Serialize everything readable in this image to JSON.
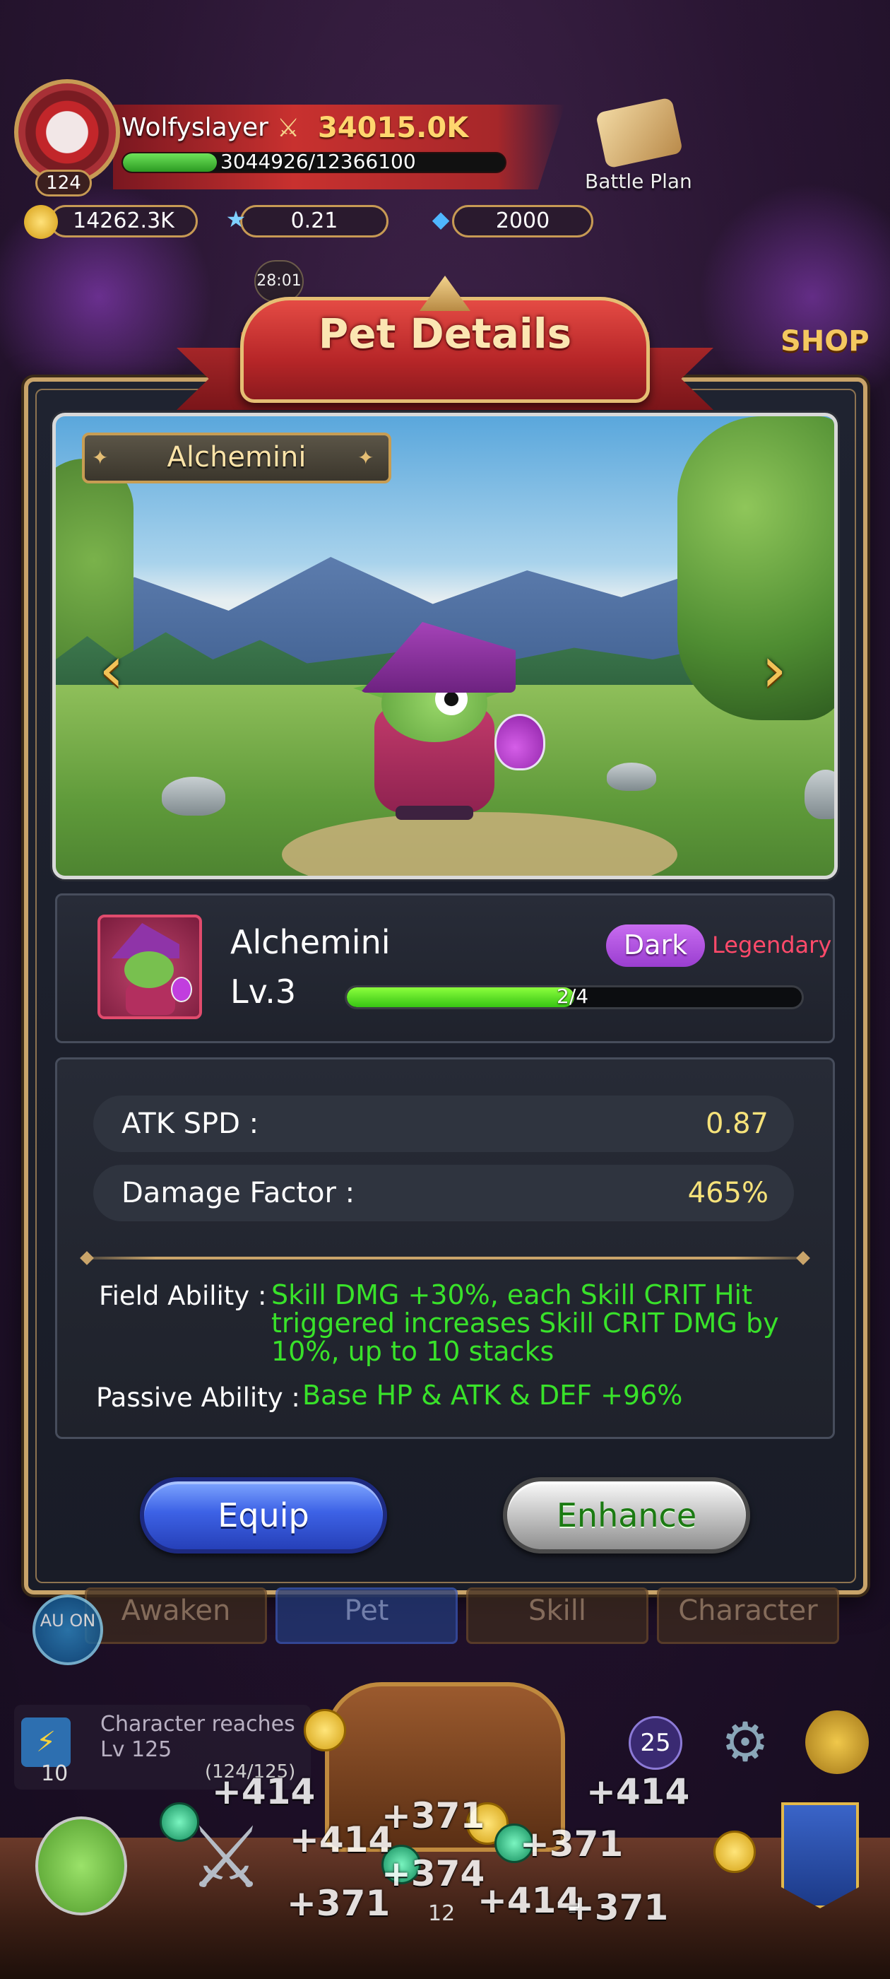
{
  "player": {
    "name": "Wolfyslayer",
    "level": "124",
    "power": "34015.0K",
    "exp_text": "3044926/12366100",
    "exp_fraction": 0.246
  },
  "hud": {
    "battle_plan_label": "Battle Plan",
    "currencies": [
      {
        "icon": "gold-coin-icon",
        "value": "14262.3K"
      },
      {
        "icon": "star-icon",
        "value": "0.21"
      },
      {
        "icon": "gem-icon",
        "value": "2000"
      }
    ],
    "timer": "28:01",
    "shop_label": "SHOP"
  },
  "modal": {
    "title": "Pet Details",
    "pet_name": "Alchemini",
    "card": {
      "name": "Alchemini",
      "level": "Lv.3",
      "element": "Dark",
      "rarity": "Legendary",
      "progress_text": "2/4",
      "progress_fraction": 0.5
    },
    "stats": [
      {
        "label": "ATK SPD :",
        "value": "0.87"
      },
      {
        "label": "Damage Factor :",
        "value": "465%"
      }
    ],
    "abilities": {
      "field_label": "Field Ability :",
      "field_lines": [
        "Skill DMG +30%, each Skill CRIT Hit",
        "triggered increases Skill CRIT DMG by",
        "10%, up to 10 stacks"
      ],
      "passive_label": "Passive Ability :",
      "passive_text": "Base HP & ATK & DEF +96%"
    },
    "buttons": {
      "equip": "Equip",
      "enhance": "Enhance"
    }
  },
  "bottom": {
    "tabs": [
      "Awaken",
      "Pet",
      "Skill",
      "Character"
    ],
    "auto_label": "AU ON",
    "quest_text_line1": "Character reaches",
    "quest_text_line2": "Lv 125",
    "quest_count": "10",
    "quest_progress": "(124/125)",
    "round": "25",
    "floating_numbers": [
      "+414",
      "+371",
      "+414",
      "+414",
      "+371",
      "+374",
      "+414",
      "+371",
      "+371",
      "+414",
      "+371"
    ],
    "bottom_counter": "12"
  },
  "colors": {
    "accent_gold": "#c9a46a",
    "ability_green": "#39e22a",
    "rarity_red": "#ff4a6a",
    "element_purple": "#b456e6",
    "stat_value_yellow": "#f6e27a"
  }
}
